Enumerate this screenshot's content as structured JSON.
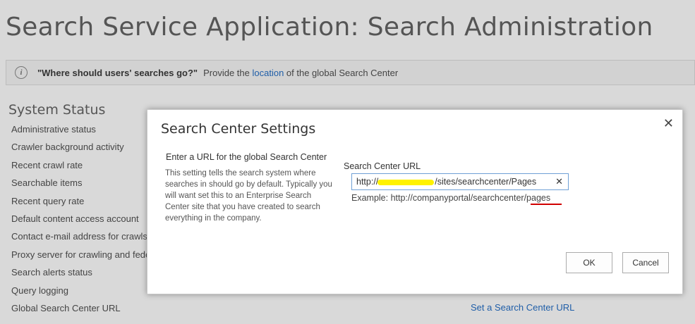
{
  "page": {
    "title": "Search Service Application: Search Administration"
  },
  "banner": {
    "icon": "info-icon",
    "bold_text": "\"Where should users' searches go?\"",
    "text_before_link": "Provide the",
    "link_text": "location",
    "text_after_link": "of the global Search Center"
  },
  "system_status": {
    "heading": "System Status",
    "items": [
      "Administrative status",
      "Crawler background activity",
      "Recent crawl rate",
      "Searchable items",
      "Recent query rate",
      "Default content access account",
      "Contact e-mail address for crawls",
      "Proxy server for crawling and fede",
      "Search alerts status",
      "Query logging",
      "Global Search Center URL"
    ],
    "set_link": "Set a Search Center URL"
  },
  "dialog": {
    "title": "Search Center Settings",
    "section_title": "Enter a URL for the global Search Center",
    "section_description": "This setting tells the search system where searches in should go by default. Typically you will want set this to an Enterprise Search Center site that you have created to search everything in the company.",
    "field_label": "Search Center URL",
    "url_value_start": "http://",
    "url_value_end": "/sites/searchcenter/Pages",
    "example": "Example: http://companyportal/searchcenter/pages",
    "ok_label": "OK",
    "cancel_label": "Cancel",
    "highlight_color": "#fff200",
    "underline_color": "#d00000"
  }
}
